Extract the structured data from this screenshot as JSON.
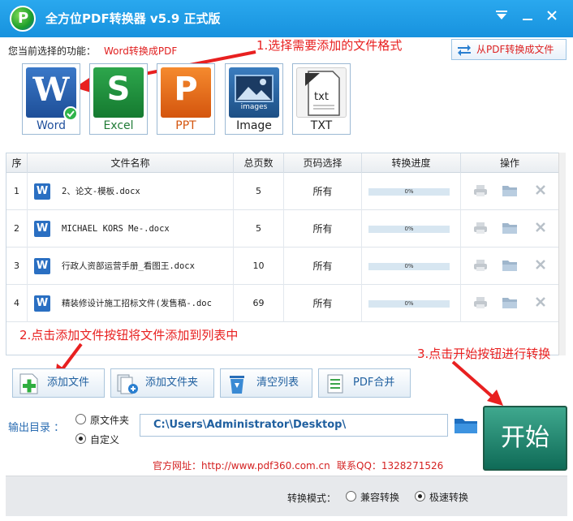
{
  "window": {
    "title": "全方位PDF转换器 v5.9 正式版",
    "logo_letter": "P"
  },
  "function_row": {
    "label": "您当前选择的功能：",
    "value": "Word转换成PDF",
    "from_pdf_label": "从PDF转换成文件"
  },
  "annotations": {
    "step1": "1.选择需要添加的文件格式",
    "step2": "2.点击添加文件按钮将文件添加到列表中",
    "step3": "3.点击开始按钮进行转换"
  },
  "formats": [
    {
      "label": "Word",
      "letter": "W",
      "color": "#2b5fae",
      "selected": true
    },
    {
      "label": "Excel",
      "letter": "S",
      "color": "#1f8a3a",
      "selected": false
    },
    {
      "label": "PPT",
      "letter": "P",
      "color": "#e86a1a",
      "selected": false
    },
    {
      "label": "Image",
      "letter": "",
      "sub": "images",
      "color": "#2b6aa8",
      "selected": false
    },
    {
      "label": "TXT",
      "letter": "",
      "sub": "txt",
      "color": "#f2f2f2",
      "selected": false
    }
  ],
  "table": {
    "headers": [
      "序",
      "文件名称",
      "总页数",
      "页码选择",
      "转换进度",
      "操作"
    ],
    "rows": [
      {
        "index": "1",
        "name": "2、论文-模板.docx",
        "pages": "5",
        "range": "所有",
        "progress": "0%",
        "progress_value": 0
      },
      {
        "index": "2",
        "name": "MICHAEL KORS Me-.docx",
        "pages": "5",
        "range": "所有",
        "progress": "0%",
        "progress_value": 0
      },
      {
        "index": "3",
        "name": "行政人资部运营手册_看图王.docx",
        "pages": "10",
        "range": "所有",
        "progress": "0%",
        "progress_value": 0
      },
      {
        "index": "4",
        "name": "精装修设计施工招标文件(发售稿-.doc",
        "pages": "69",
        "range": "所有",
        "progress": "0%",
        "progress_value": 0
      }
    ]
  },
  "toolbar": {
    "add_file": "添加文件",
    "add_folder": "添加文件夹",
    "clear_list": "清空列表",
    "pdf_merge": "PDF合并"
  },
  "output": {
    "label": "输出目录 ：",
    "option_original": "原文件夹",
    "option_custom": "自定义",
    "selected": "custom",
    "path": "C:\\Users\\Administrator\\Desktop\\"
  },
  "start_label": "开始",
  "contact": {
    "site": "官方网址：http://www.pdf360.com.cn",
    "qq": "联系QQ：1328271526"
  },
  "mode": {
    "label": "转换模式：",
    "compatible": "兼容转换",
    "fast": "极速转换",
    "selected": "fast"
  },
  "colors": {
    "titlebar": "#1792de",
    "accent_red": "#e82020",
    "start_green": "#0f6b57"
  }
}
